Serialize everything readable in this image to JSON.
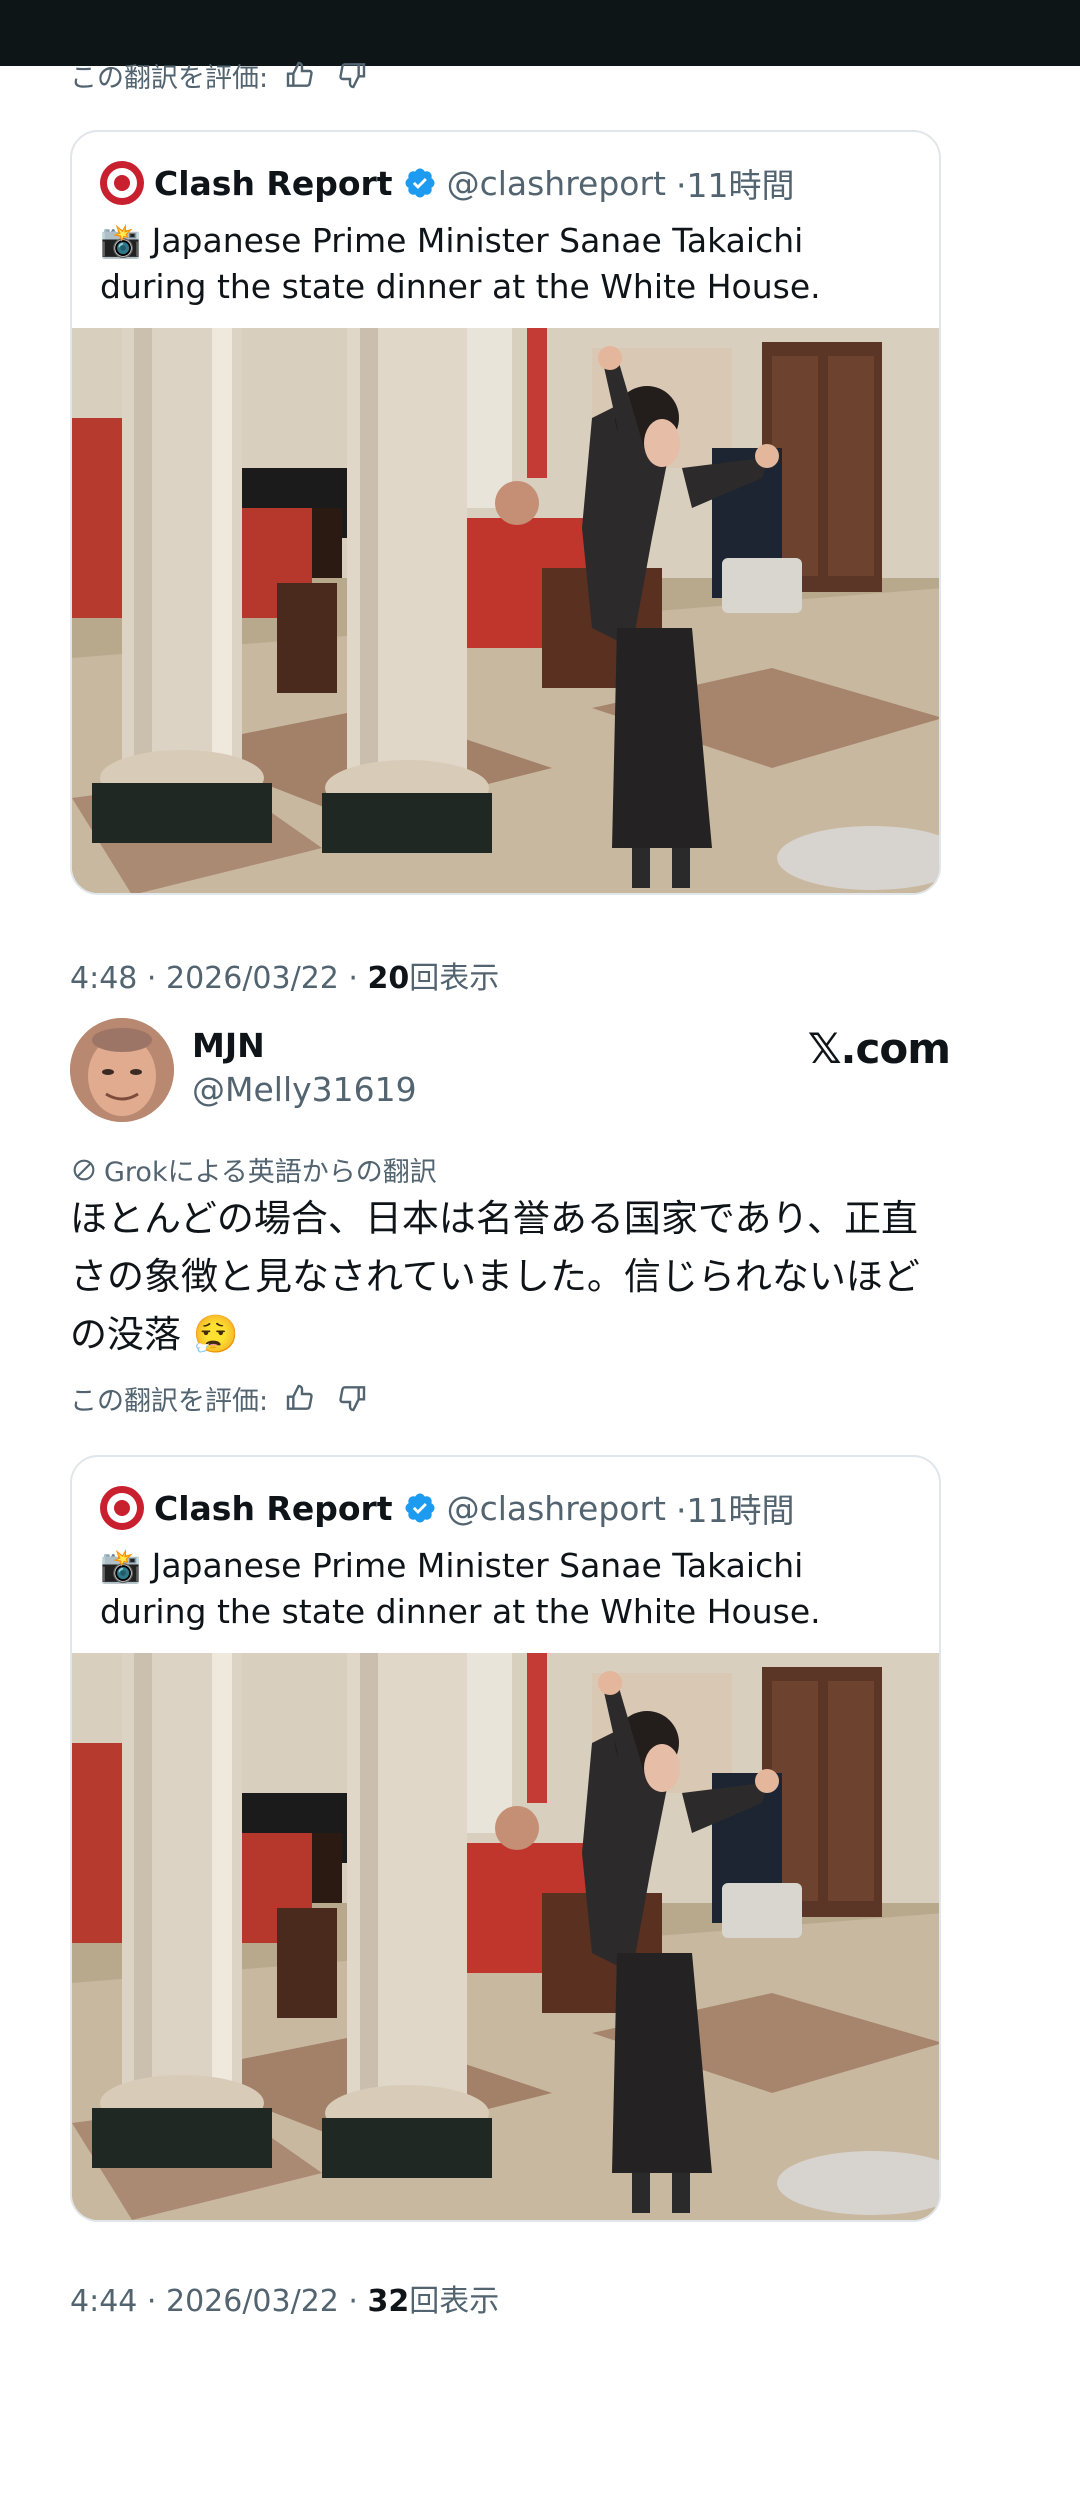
{
  "rate_label": "この翻訳を評価:",
  "quote": {
    "name": "Clash Report",
    "handle": "@clashreport",
    "time": "·11時間",
    "emoji": "📸",
    "text": "Japanese Prime Minister Sanae Takaichi during the state dinner at the White House."
  },
  "tweet1_meta": {
    "time": "4:48 · 2026/03/22 · ",
    "views_count": "20",
    "views_label": "回表示"
  },
  "author": {
    "name": "MJN",
    "handle": "@Melly31619",
    "brand": "𝕏.com"
  },
  "translation_note": "Grokによる英語からの翻訳",
  "body_text": "ほとんどの場合、日本は名誉ある国家であり、正直さの象徴と見なされていました。信じられないほどの没落 😮‍💨",
  "tweet2_meta": {
    "time": "4:44 · 2026/03/22 · ",
    "views_count": "32",
    "views_label": "回表示"
  },
  "icons": {
    "verified": "verified-badge-icon",
    "thumbs_up": "thumbs-up-icon",
    "thumbs_down": "thumbs-down-icon",
    "translate": "translate-icon"
  },
  "colors": {
    "text": "#0f1419",
    "secondary": "#536471",
    "verified": "#1d9bf0",
    "clash_red": "#c8202e",
    "status_bar": "#0d1517"
  }
}
